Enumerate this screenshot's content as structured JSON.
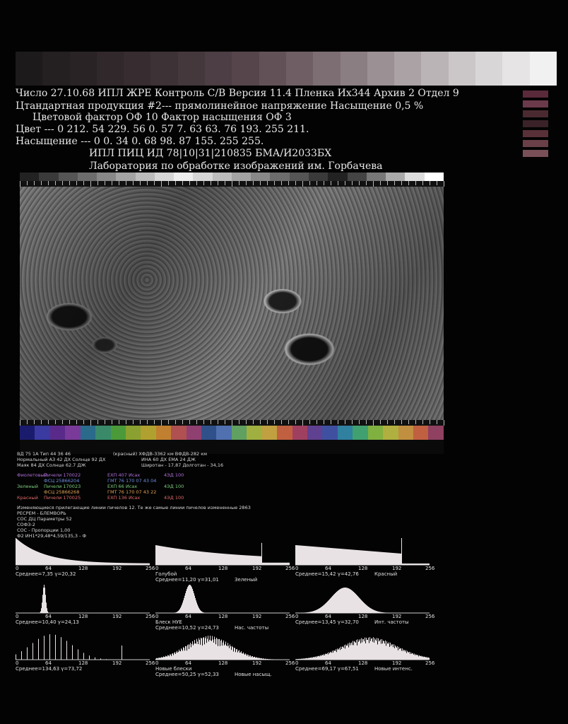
{
  "header": {
    "line1": "Число 27.10.68  ИПЛ  ЖРЕ Контроль С/В  Версия  11.4  Пленка Их344  Архив 2 Отдел 9",
    "line2": "Цтандартная продукция  #2--- прямолинейное напряжение  Насыщение 0,5 %",
    "line3": "Цветовой фактор  ОФ 10       Фактор насыщения  ОФ  3",
    "line4": "Цвет ---  0 212. 54 229. 56 0. 57 7. 63 63. 76 193. 255 211.",
    "line5": "Насыщение --- 0 0. 34 0. 68 98. 87 155. 255 255.",
    "line6": "ИПЛ ПИЦ ИД  78|10|31|210835     БМА/И2033БХ",
    "line7": "Лаборатория по обработке изображений им. Горбачева"
  },
  "colors": {
    "background": "#030303",
    "grayscale_steps": [
      "#1c1a1b",
      "#241f21",
      "#2a2326",
      "#30282b",
      "#372c30",
      "#3d3236",
      "#45383c",
      "#4c3e44",
      "#56464b",
      "#625257",
      "#6f5f64",
      "#7d6e73",
      "#8b7e83",
      "#9b9093",
      "#aba2a5",
      "#bbb4b6",
      "#cbc6c8",
      "#d9d6d7",
      "#e6e4e5",
      "#f2f1f1"
    ],
    "top_strip": [
      "#222",
      "#3a3a3a",
      "#555",
      "#6d6d6d",
      "#888",
      "#a3a3a3",
      "#bcbcbc",
      "#d6d6d6",
      "#eee",
      "#d6d6d6",
      "#bcbcbc",
      "#a3a3a3",
      "#888",
      "#6d6d6d",
      "#555",
      "#3a3a3a",
      "#222",
      "#444",
      "#777",
      "#aaa",
      "#ddd",
      "#fff"
    ],
    "bottom_strip": [
      "#1b1b6e",
      "#3a3aa0",
      "#5a2a8a",
      "#7a3a9a",
      "#2a6a8a",
      "#3a8a6a",
      "#4a9a3a",
      "#8aa030",
      "#b0a030",
      "#c08030",
      "#b05050",
      "#904070",
      "#30508a",
      "#5070b0",
      "#60a060",
      "#a0b040",
      "#c0a040",
      "#c06040",
      "#a04060",
      "#604090",
      "#4050a0",
      "#3080a0",
      "#40a070",
      "#80b040",
      "#b0b040",
      "#c09040",
      "#c06040",
      "#904060"
    ],
    "side_swatches": [
      "#5a2a3a",
      "#6b3a4a",
      "#4a2a30",
      "#3a2228",
      "#5a3038",
      "#6a4048",
      "#7a5058"
    ]
  },
  "info": {
    "l1a": "ВД 75 1А  Тип 44 36 46",
    "l1b": "(красный)   ХФДВ-3362 км  ВФДВ-282 км",
    "l2a": "Нормальный АЗ 42 ДХ Солнце 92 ДХ",
    "l2b": "ИНА 60 ДХ ЕМА  24 ДЖ",
    "l3a": "Маяк 84 ДХ  Солнце 62.7 ДЖ",
    "l3b": "Широтан - 17,87  Долготан - 34,16",
    "rows": [
      {
        "name": "Фиолетовый",
        "cls": "c-purple",
        "a": "Пичели 170022",
        "b": "ЕХП  407  Исах",
        "c": "4ЭД  100"
      },
      {
        "name": "",
        "cls": "c-blue",
        "a": "ФСЦ  25866204",
        "b": "ГМТ  76 170 07 43 04",
        "c": ""
      },
      {
        "name": "Зеленый",
        "cls": "c-green",
        "a": "Пичели 170023",
        "b": "ЕХП  66  Исах",
        "c": "4ЭД  100"
      },
      {
        "name": "",
        "cls": "c-orange",
        "a": "ФСЦ  25866268",
        "b": "ГМТ  76 170 07 43 22",
        "c": ""
      },
      {
        "name": "Красный",
        "cls": "c-red",
        "a": "Пичели 170025",
        "b": "ЕХП  136 Исах",
        "c": "4ЭД  100"
      }
    ],
    "p1": "Изменяющиеся прилегающие линии пичелов   12.  Те же самые линии пичелов  измененные   2863",
    "p2": "РЕСРЕМ  - БЛЕМВОРЬ",
    "p3": "СОС ДЦ  Параметры  52",
    "p4": "СОФЗ-2",
    "p5": "СОС  - Пропорции  1,00",
    "p6": "Ф2  ИН1*29,48*4,59/135,3 - Ф"
  },
  "histograms": [
    {
      "ticks": [
        "0",
        "64",
        "128",
        "192",
        "256"
      ],
      "label": "Среднее=7,35  γ=20,32",
      "sub": "",
      "name": ""
    },
    {
      "ticks": [
        "0",
        "64",
        "128",
        "192",
        "256"
      ],
      "label": "Среднее=11,20  γ=31,01",
      "sub": "Голубой",
      "name": "Зеленый"
    },
    {
      "ticks": [
        "0",
        "64",
        "128",
        "192",
        "256"
      ],
      "label": "Среднее=15,42  γ=42,76",
      "sub": "",
      "name": "Красный"
    },
    {
      "ticks": [
        "0",
        "64",
        "128",
        "192",
        "256"
      ],
      "label": "Среднее=10,40  γ=24,13",
      "sub": "",
      "name": ""
    },
    {
      "ticks": [
        "0",
        "64",
        "128",
        "192",
        "256"
      ],
      "label": "Среднее=10,52  γ=24,73",
      "sub": "Блеск НУЕ",
      "name": "Нас. частоты"
    },
    {
      "ticks": [
        "0",
        "64",
        "128",
        "192",
        "256"
      ],
      "label": "Среднее=13,45  γ=32,70",
      "sub": "",
      "name": "Инт.  частоты"
    },
    {
      "ticks": [
        "0",
        "64",
        "128",
        "192",
        "256"
      ],
      "label": "Среднее=134,63  γ=73,72",
      "sub": "",
      "name": ""
    },
    {
      "ticks": [
        "0",
        "64",
        "128",
        "192",
        "256"
      ],
      "label": "Среднее=50,25  γ=52,33",
      "sub": "Новые блески",
      "name": "Новые насыщ."
    },
    {
      "ticks": [
        "0",
        "64",
        "128",
        "192",
        "256"
      ],
      "label": "Среднее=69,17  γ=67,51",
      "sub": "",
      "name": "Новые интенс."
    }
  ]
}
